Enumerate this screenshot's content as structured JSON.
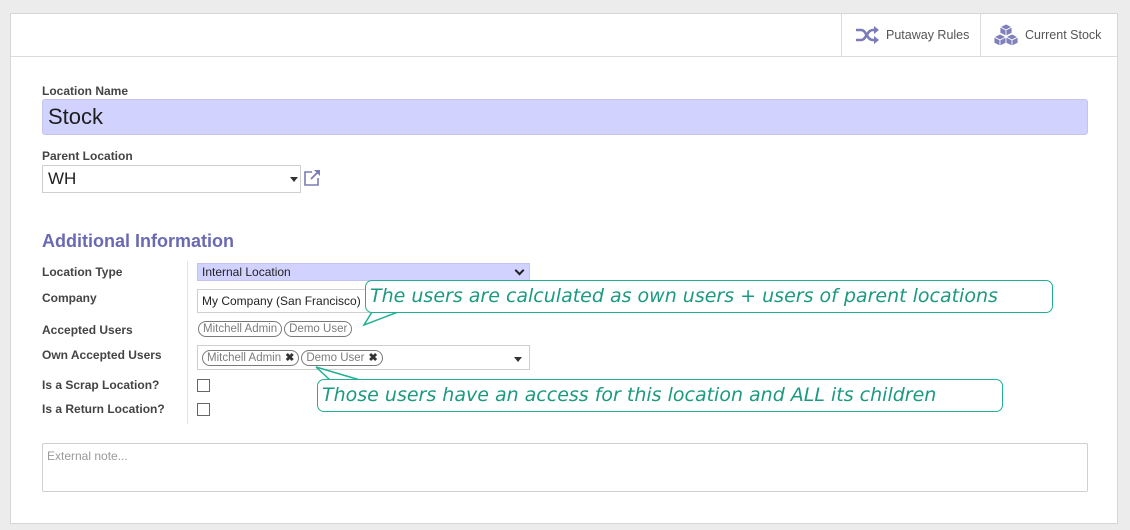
{
  "stat_buttons": [
    {
      "label": "Putaway Rules",
      "icon": "shuffle-icon"
    },
    {
      "label": "Current Stock",
      "icon": "cubes-icon"
    }
  ],
  "form": {
    "location_name_label": "Location Name",
    "location_name_value": "Stock",
    "parent_location_label": "Parent Location",
    "parent_location_value": "WH",
    "section_title": "Additional Information",
    "fields": {
      "location_type_label": "Location Type",
      "location_type_value": "Internal Location",
      "company_label": "Company",
      "company_value": "My Company (San Francisco)",
      "accepted_users_label": "Accepted Users",
      "accepted_users": [
        "Mitchell Admin",
        "Demo User"
      ],
      "own_accepted_users_label": "Own Accepted Users",
      "own_accepted_users": [
        "Mitchell Admin",
        "Demo User"
      ],
      "scrap_label": "Is a Scrap Location?",
      "scrap_checked": false,
      "return_label": "Is a Return Location?",
      "return_checked": false
    },
    "note_placeholder": "External note..."
  },
  "callouts": [
    "The users are calculated as own users + users of parent locations",
    "Those users have an access for this location and ALL its children"
  ],
  "colors": {
    "accent": "#6a6ab4",
    "required_bg": "#d2d2ff",
    "callout": "#1fb192"
  }
}
